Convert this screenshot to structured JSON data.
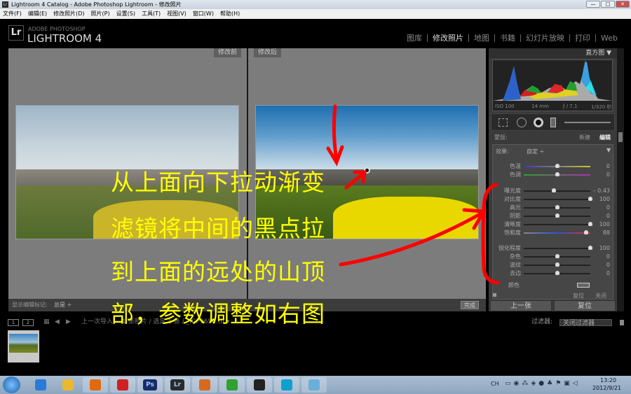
{
  "window": {
    "title": "Lightroom 4 Catalog - Adobe Photoshop Lightroom - 修改照片",
    "app_icon": "Lr",
    "controls": [
      "—",
      "□",
      "✕"
    ]
  },
  "menu": [
    "文件(F)",
    "编辑(E)",
    "修改照片(D)",
    "照片(P)",
    "设置(S)",
    "工具(T)",
    "视图(V)",
    "窗口(W)",
    "帮助(H)"
  ],
  "logo": {
    "mark": "Lr",
    "sub": "ADOBE PHOTOSHOP",
    "main": "LIGHTROOM 4"
  },
  "modules": [
    {
      "label": "图库"
    },
    {
      "label": "修改照片",
      "active": true
    },
    {
      "label": "地图"
    },
    {
      "label": "书籍"
    },
    {
      "label": "幻灯片放映"
    },
    {
      "label": "打印"
    },
    {
      "label": "Web"
    }
  ],
  "view": {
    "before_label": "修改前",
    "after_label": "修改后"
  },
  "toolbar": {
    "show_marks_label": "显示编辑标记:",
    "show_marks_value": "总是 ÷",
    "done_button": "完成"
  },
  "right_panel": {
    "histogram_title": "直方图 ▼",
    "exif": {
      "iso": "ISO 100",
      "focal": "14 mm",
      "aperture": "ƒ / 7.1",
      "shutter": "1/320 秒"
    },
    "mask_label": "蒙版:",
    "mask_new": "新建",
    "mask_edit": "编辑",
    "effect_label": "效果:",
    "effect_value": "自定 ÷",
    "sliders": [
      {
        "label": "色温",
        "value": "0",
        "position": 0.5,
        "group": 0,
        "color": "temp"
      },
      {
        "label": "色调",
        "value": "0",
        "position": 0.5,
        "group": 0,
        "color": "tint"
      },
      {
        "label": "曝光度",
        "value": "– 0.43",
        "position": 0.45,
        "group": 1
      },
      {
        "label": "对比度",
        "value": "100",
        "position": 1,
        "group": 1
      },
      {
        "label": "高光",
        "value": "0",
        "position": 0.5,
        "group": 1
      },
      {
        "label": "阴影",
        "value": "0",
        "position": 0.5,
        "group": 1
      },
      {
        "label": "清晰度",
        "value": "100",
        "position": 1,
        "group": 1
      },
      {
        "label": "饱和度",
        "value": "88",
        "position": 0.94,
        "group": 1,
        "color": "sat"
      },
      {
        "label": "锐化程度",
        "value": "100",
        "position": 1,
        "group": 2
      },
      {
        "label": "杂色",
        "value": "0",
        "position": 0.5,
        "group": 2
      },
      {
        "label": "波纹",
        "value": "0",
        "position": 0.5,
        "group": 2
      },
      {
        "label": "去边",
        "value": "0",
        "position": 0.5,
        "group": 2
      }
    ],
    "color_label": "颜色",
    "reset_small": "复位",
    "close_small": "关闭",
    "prev_button": "上一张",
    "reset_button": "复位"
  },
  "filmstrip": {
    "page1": "1",
    "page2": "2",
    "source": "上一次导入",
    "info": "1 张照片 / 选定 1 张 / _IGP9654.tif ▾",
    "filter_label": "过滤器:",
    "filter_value": "关闭过滤器"
  },
  "annotation": [
    "从上面向下拉动渐变",
    "滤镜将中间的黑点拉",
    "到上面的远处的山顶",
    "部，参数调整如右图"
  ],
  "taskbar": {
    "apps": [
      "IE",
      "Explorer",
      "Media",
      "Flash",
      "Ps",
      "Lr",
      "Viewer",
      "360",
      "QQ",
      "Video",
      "Notepad"
    ],
    "tray_lang": "CH",
    "time": "13:20",
    "date": "2012/9/21"
  },
  "colors": {
    "annotation": "#ffff00",
    "arrow": "#ff0000",
    "panel": "#3a3a3a",
    "center": "#7c7c7c"
  }
}
